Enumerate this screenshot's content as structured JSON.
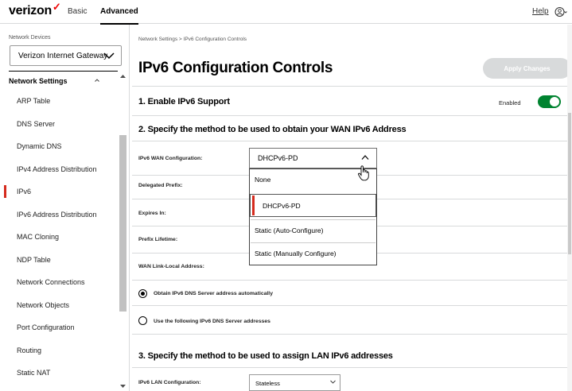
{
  "header": {
    "logo_text": "verizon",
    "logo_check": "✓",
    "nav_basic": "Basic",
    "nav_advanced": "Advanced",
    "help": "Help",
    "user_icon": "user-circle-icon"
  },
  "sidebar": {
    "device_label": "Network Devices",
    "device_value": "Verizon Internet Gateway",
    "section_title": "Network Settings",
    "active_item": "IPv6",
    "items": [
      {
        "label": "ARP Table"
      },
      {
        "label": "DNS Server"
      },
      {
        "label": "Dynamic DNS"
      },
      {
        "label": "IPv4 Address Distribution"
      },
      {
        "label": "IPv6"
      },
      {
        "label": "IPv6 Address Distribution"
      },
      {
        "label": "MAC Cloning"
      },
      {
        "label": "NDP Table"
      },
      {
        "label": "Network Connections"
      },
      {
        "label": "Network Objects"
      },
      {
        "label": "Port Configuration"
      },
      {
        "label": "Routing"
      },
      {
        "label": "Static NAT"
      }
    ]
  },
  "main": {
    "breadcrumb": "Network Settings  >  IPv6 Configuration Controls",
    "title": "IPv6 Configuration Controls",
    "apply_button": "Apply Changes",
    "section1": {
      "title": "1. Enable IPv6 Support",
      "toggle_label": "Enabled",
      "toggle_on": true
    },
    "section2": {
      "title": "2. Specify the method to be used to obtain your WAN IPv6 Address",
      "wan_config_label": "IPv6 WAN Configuration:",
      "wan_config_value": "DHCPv6-PD",
      "delegated_prefix_label": "Delegated Prefix:",
      "expires_in_label": "Expires In:",
      "prefix_lifetime_label": "Prefix Lifetime:",
      "link_local_label": "WAN Link-Local Address:",
      "dns_auto_label": "Obtain IPv6 DNS Server address automatically",
      "dns_manual_label": "Use the following IPv6 DNS Server addresses",
      "dns_auto_selected": true
    },
    "dropdown": {
      "options": [
        "None",
        "DHCPv6-PD",
        "Static (Auto-Configure)",
        "Static (Manually Configure)"
      ],
      "selected": "DHCPv6-PD"
    },
    "section3": {
      "title": "3. Specify the method to be used to assign LAN IPv6 addresses",
      "lan_config_label": "IPv6 LAN Configuration:",
      "lan_config_value": "Stateless"
    }
  },
  "colors": {
    "accent_red": "#d52b1e",
    "toggle_green": "#008330",
    "button_disabled": "#d8dadb"
  }
}
